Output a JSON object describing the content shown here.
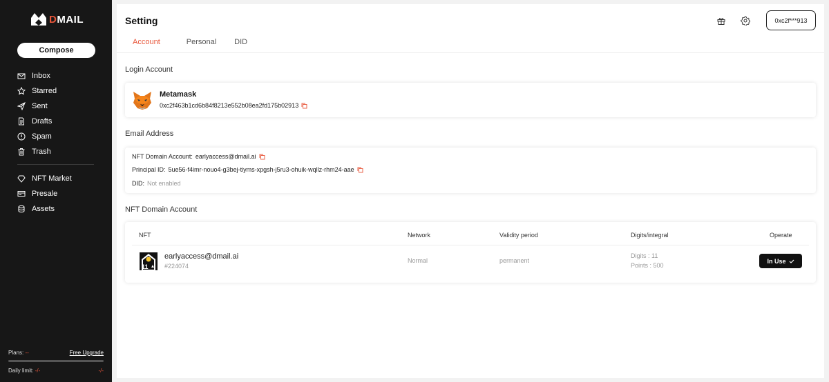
{
  "brand": {
    "logo_d": "D",
    "logo_rest": "MAIL",
    "accent": "#e8563a"
  },
  "sidebar": {
    "compose_label": "Compose",
    "items": [
      {
        "label": "Inbox",
        "icon": "inbox-icon"
      },
      {
        "label": "Starred",
        "icon": "star-icon"
      },
      {
        "label": "Sent",
        "icon": "send-icon"
      },
      {
        "label": "Drafts",
        "icon": "drafts-icon"
      },
      {
        "label": "Spam",
        "icon": "spam-icon"
      },
      {
        "label": "Trash",
        "icon": "trash-icon"
      }
    ],
    "extra_items": [
      {
        "label": "NFT Market",
        "icon": "nft-market-icon"
      },
      {
        "label": "Presale",
        "icon": "presale-icon"
      },
      {
        "label": "Assets",
        "icon": "assets-icon"
      }
    ],
    "plans_label": "Plans:",
    "plans_value": "--",
    "upgrade_label": "Free Upgrade",
    "plan_usage_fraction": 0,
    "daily_limit_label": "Daily limit:",
    "daily_limit_value": "-/-",
    "daily_limit_right": "-/-"
  },
  "header": {
    "title": "Setting",
    "wallet_label": "0xc2f***913",
    "icons": [
      "gift-icon",
      "gear-icon"
    ]
  },
  "tabs": [
    {
      "label": "Account",
      "active": true
    },
    {
      "label": "Personal",
      "active": false
    },
    {
      "label": "DID",
      "active": false
    }
  ],
  "login_account": {
    "section_label": "Login Account",
    "wallet_name": "Metamask",
    "address": "0xc2f463b1cd6b84f8213e552b08ea2fd175b02913"
  },
  "email_address": {
    "section_label": "Email Address",
    "nft_domain_label": "NFT Domain Account:",
    "nft_domain_value": "earlyaccess@dmail.ai",
    "principal_label": "Principal ID:",
    "principal_value": "5ue56-f4imr-nouo4-g3bej-tiyms-xpgsh-j5ru3-ohuik-wqllz-rhm24-aae",
    "did_label": "DID:",
    "did_value": "Not enabled"
  },
  "nft_domain_account": {
    "section_label": "NFT Domain Account",
    "columns": [
      "NFT",
      "Network",
      "Validity period",
      "Digits/integral",
      "Operate"
    ],
    "rows": [
      {
        "email": "earlyaccess@dmail.ai",
        "id": "#224074",
        "badge_number": "11",
        "network": "Normal",
        "validity": "permanent",
        "digits": "Digits : 11",
        "points": "Points : 500",
        "operate_label": "In Use"
      }
    ]
  }
}
